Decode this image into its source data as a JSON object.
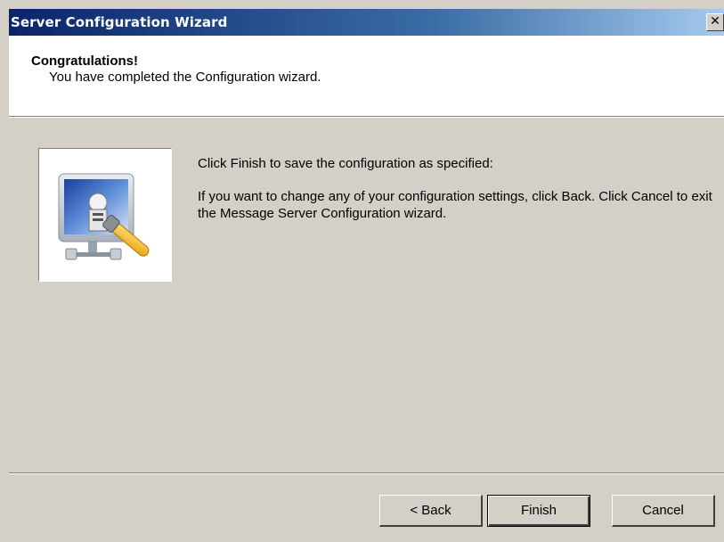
{
  "window": {
    "title": "Server Configuration Wizard",
    "close_glyph": "✕"
  },
  "header": {
    "heading": "Congratulations!",
    "subheading": "You have completed the Configuration wizard."
  },
  "body": {
    "image_icon": "server-config-icon",
    "message_line1": "Click Finish to save the configuration as specified:",
    "message_line2": "If you want to change any of your configuration settings, click Back. Click Cancel to exit the Message Server Configuration wizard."
  },
  "buttons": {
    "back": "< Back",
    "finish": "Finish",
    "cancel": "Cancel"
  },
  "colors": {
    "title_gradient_start": "#0a246a",
    "title_gradient_end": "#a6caf0",
    "dialog_face": "#d4d0c8"
  }
}
